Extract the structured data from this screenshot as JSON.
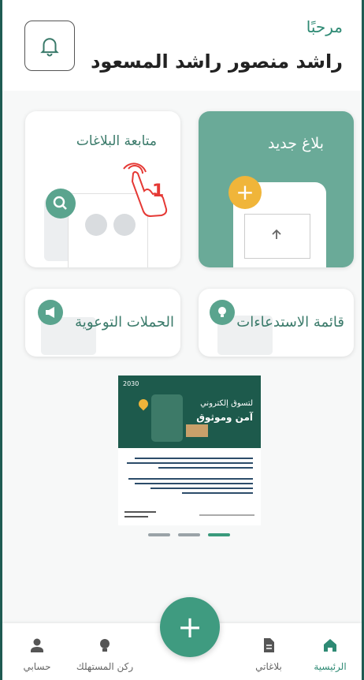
{
  "header": {
    "greeting": "مرحبًا",
    "user_name": "راشد منصور راشد المسعود"
  },
  "cards": {
    "new_report": "بلاغ جديد",
    "track_reports": "متابعة البلاغات",
    "recalls_list": "قائمة الاستدعاءات",
    "awareness_campaigns": "الحملات التوعوية"
  },
  "annotation": {
    "step_number": "1"
  },
  "banner": {
    "year_mark": "2030",
    "headline_1": "لتسوق إلكتروني",
    "headline_2": "آمن وموثوق"
  },
  "carousel": {
    "page_count": 3,
    "active_index": 2
  },
  "tabbar": {
    "home": "الرئيسية",
    "my_reports": "بلاغاتي",
    "consumer_corner": "ركن المستهلك",
    "my_account": "حسابي"
  },
  "colors": {
    "accent": "#3f9b80",
    "primary_card": "#6aaa98",
    "text_green": "#2e8a74"
  }
}
